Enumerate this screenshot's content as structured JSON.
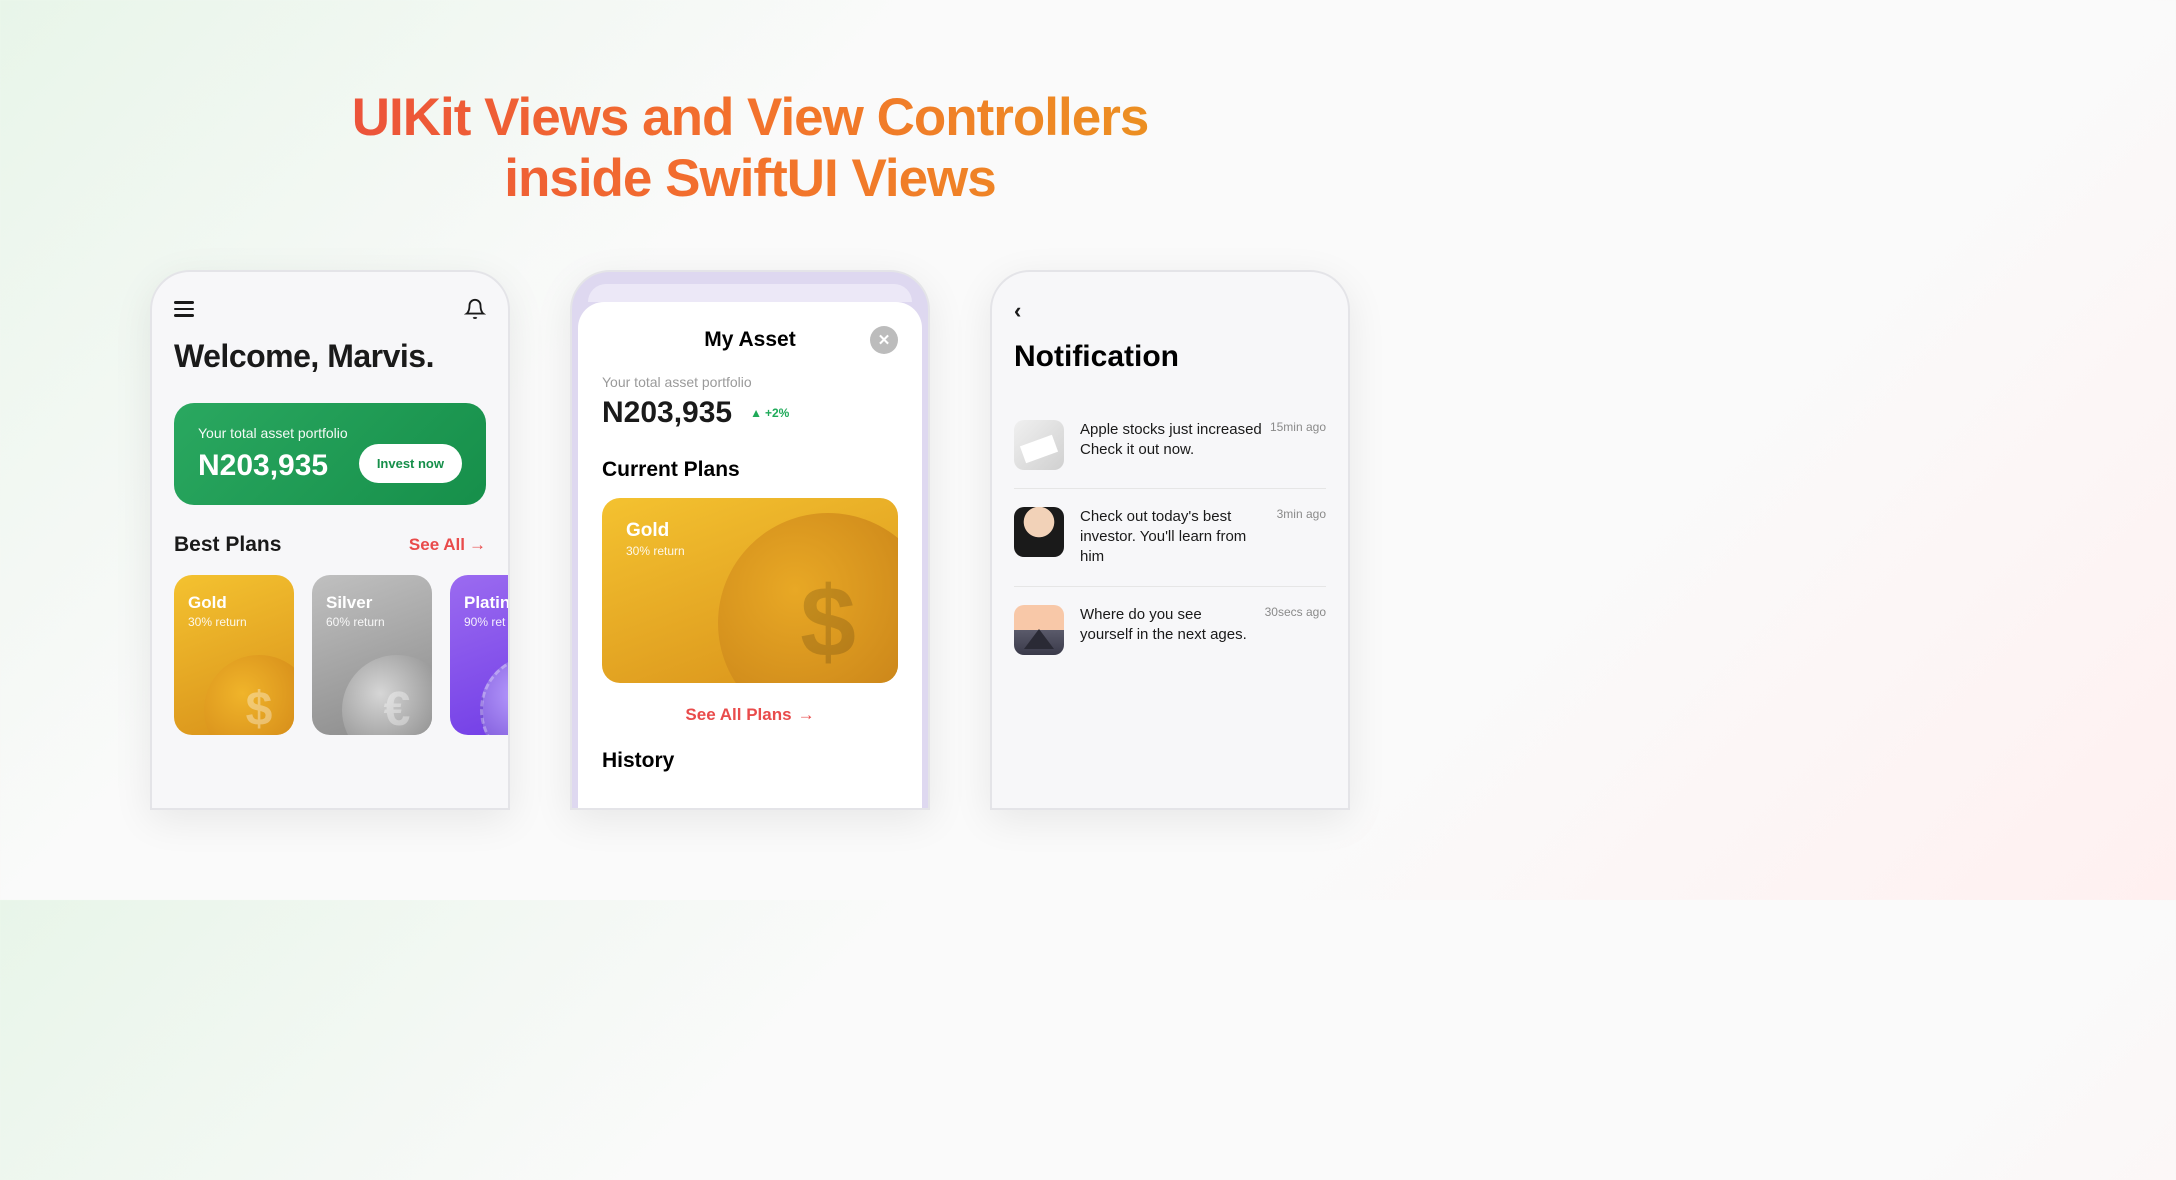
{
  "hero": {
    "line1": "UIKit Views and View Controllers",
    "line2": "inside SwiftUI Views"
  },
  "phone1": {
    "welcome": "Welcome, Marvis.",
    "portfolio": {
      "label": "Your total asset portfolio",
      "amount": "N203,935",
      "invest_label": "Invest now"
    },
    "best_plans_title": "Best Plans",
    "see_all_label": "See All",
    "plans": [
      {
        "name": "Gold",
        "return": "30% return",
        "symbol": "$"
      },
      {
        "name": "Silver",
        "return": "60% return",
        "symbol": "€"
      },
      {
        "name": "Platin",
        "return": "90% ret",
        "symbol": ""
      }
    ]
  },
  "phone2": {
    "title": "My Asset",
    "asset_label": "Your total asset portfolio",
    "asset_amount": "N203,935",
    "asset_change": "+2%",
    "current_plans_title": "Current Plans",
    "big_plan": {
      "name": "Gold",
      "return": "30% return"
    },
    "see_all_plans": "See All Plans",
    "history_title": "History"
  },
  "phone3": {
    "title": "Notification",
    "items": [
      {
        "text": "Apple stocks just increased Check it out now.",
        "time": "15min ago"
      },
      {
        "text": "Check out today's best investor. You'll learn from him",
        "time": "3min ago"
      },
      {
        "text": "Where do you see yourself in the next ages.",
        "time": "30secs ago"
      }
    ]
  }
}
